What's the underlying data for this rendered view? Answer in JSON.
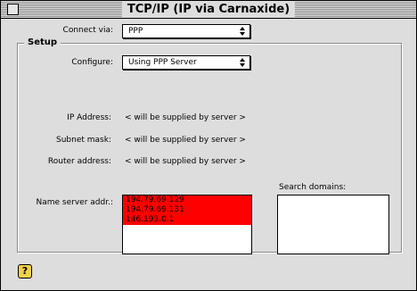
{
  "window": {
    "title": "TCP/IP (IP via Carnaxide)"
  },
  "connect_via": {
    "label": "Connect via:",
    "value": "PPP"
  },
  "setup": {
    "title": "Setup",
    "configure_label": "Configure:",
    "configure_value": "Using PPP Server",
    "ip_label": "IP Address:",
    "ip_value": "< will be supplied by server >",
    "subnet_label": "Subnet mask:",
    "subnet_value": "< will be supplied by server >",
    "router_label": "Router address:",
    "router_value": "< will be supplied by server >",
    "nameserver_label": "Name server addr.:",
    "name_servers": [
      "194.79.69.129",
      "194.79.69.131",
      "146.193.0.1"
    ],
    "search_label": "Search domains:",
    "search_domains": []
  },
  "help": {
    "glyph": "?"
  },
  "colors": {
    "selection": "#ff0000",
    "window_bg": "#dddddd"
  }
}
